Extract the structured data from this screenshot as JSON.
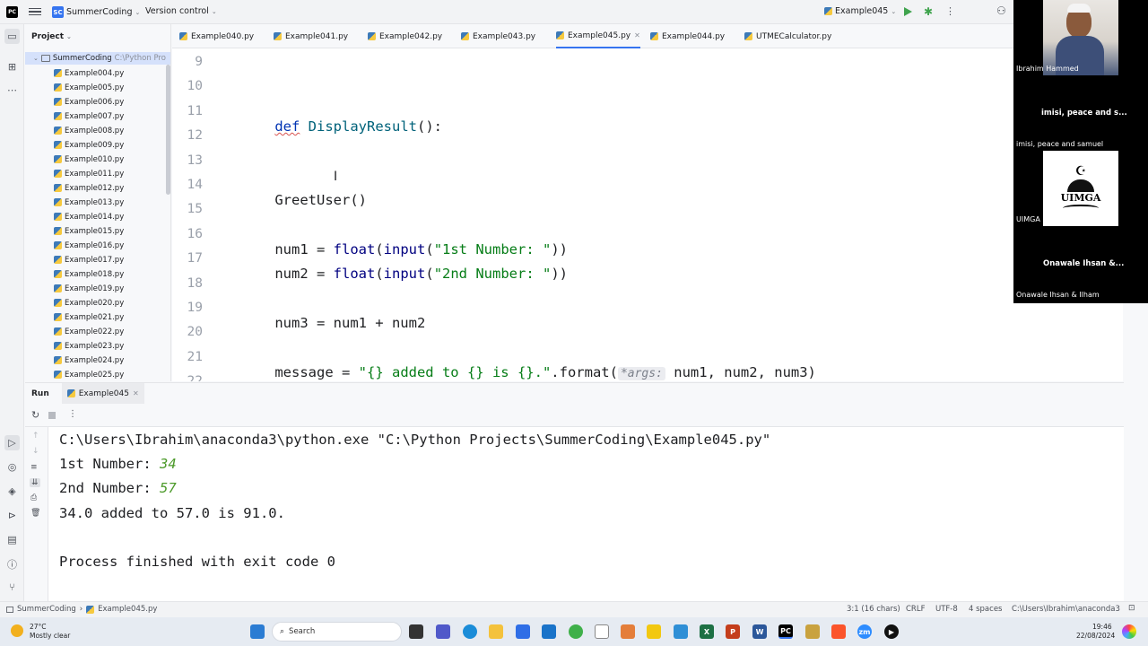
{
  "titlebar": {
    "project_badge": "SC",
    "project_name": "SummerCoding",
    "vcs_label": "Version control",
    "run_config": "Example045"
  },
  "project_panel": {
    "title": "Project",
    "root_name": "SummerCoding",
    "root_path": "C:\\Python Pro",
    "files": [
      "Example004.py",
      "Example005.py",
      "Example006.py",
      "Example007.py",
      "Example008.py",
      "Example009.py",
      "Example010.py",
      "Example011.py",
      "Example012.py",
      "Example013.py",
      "Example014.py",
      "Example015.py",
      "Example016.py",
      "Example017.py",
      "Example018.py",
      "Example019.py",
      "Example020.py",
      "Example021.py",
      "Example022.py",
      "Example023.py",
      "Example024.py",
      "Example025.py"
    ]
  },
  "tabs": [
    {
      "label": "Example040.py",
      "active": false
    },
    {
      "label": "Example041.py",
      "active": false
    },
    {
      "label": "Example042.py",
      "active": false
    },
    {
      "label": "Example043.py",
      "active": false
    },
    {
      "label": "Example045.py",
      "active": true
    },
    {
      "label": "Example044.py",
      "active": false
    },
    {
      "label": "UTMECalculator.py",
      "active": false
    }
  ],
  "editor": {
    "line_numbers": [
      "9",
      "10",
      "11",
      "12",
      "13",
      "14",
      "15",
      "16",
      "17",
      "18",
      "19",
      "20",
      "21",
      "22"
    ],
    "lines": {
      "l11": {
        "kw": "def",
        "fn": "DisplayResult",
        "rest": "():"
      },
      "l14": "GreetUser()",
      "l16": {
        "pre": "num1 = ",
        "fn1": "float",
        "p1": "(",
        "fn2": "input",
        "p2": "(",
        "str": "\"1st Number: \"",
        "post": "))"
      },
      "l17": {
        "pre": "num2 = ",
        "fn1": "float",
        "p1": "(",
        "fn2": "input",
        "p2": "(",
        "str": "\"2nd Number: \"",
        "post": "))"
      },
      "l19": "num3 = num1 + num2",
      "l21": {
        "pre": "message = ",
        "str": "\"{} added to {} is {}.\"",
        "mid": ".format(",
        "hint": "*args:",
        "post": " num1, num2, num3)"
      }
    }
  },
  "video_panel": {
    "participants": [
      {
        "name": "Ibrahim Hammed"
      },
      {
        "name": "imisi, peace and s...",
        "sub": "imisi, peace and samuel"
      },
      {
        "name": "UIMGA LAGOS CHAPTER",
        "logo_text": "UIMGA"
      },
      {
        "name": "Onawale Ihsan &...",
        "sub": "Onawale Ihsan & Ilham"
      }
    ]
  },
  "run_panel": {
    "tab_run": "Run",
    "tab_config": "Example045",
    "console_lines": [
      {
        "text": "C:\\Users\\Ibrahim\\anaconda3\\python.exe \"C:\\Python Projects\\SummerCoding\\Example045.py\""
      },
      {
        "prompt": "1st Number: ",
        "input": "34"
      },
      {
        "prompt": "2nd Number: ",
        "input": "57"
      },
      {
        "text": "34.0 added to 57.0 is 91.0."
      },
      {
        "text": ""
      },
      {
        "text": "Process finished with exit code 0"
      }
    ]
  },
  "statusbar": {
    "crumb_project": "SummerCoding",
    "crumb_file": "Example045.py",
    "position": "3:1 (16 chars)",
    "line_sep": "CRLF",
    "encoding": "UTF-8",
    "indent": "4 spaces",
    "interpreter": "C:\\Users\\Ibrahim\\anaconda3"
  },
  "taskbar": {
    "weather_temp": "27°C",
    "weather_desc": "Mostly clear",
    "search_placeholder": "Search",
    "time": "19:46",
    "date": "22/08/2024"
  },
  "colors": {
    "accent": "#3574f0",
    "keyword": "#0033b3",
    "string": "#067d17",
    "function": "#00627a",
    "input_value": "#4c9a2a"
  }
}
